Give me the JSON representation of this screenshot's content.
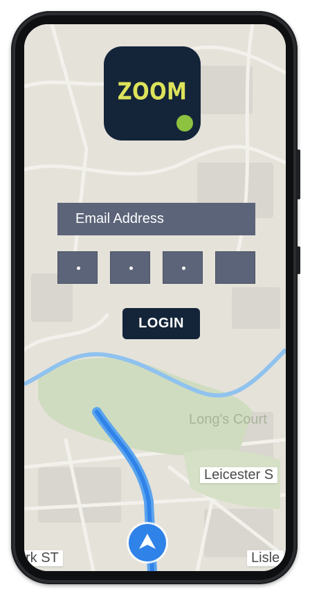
{
  "app": {
    "logo_text": "ZOOM",
    "colors": {
      "brand_navy": "#14253a",
      "logo_yellow": "#dde35a",
      "logo_dot_green": "#8cc23f",
      "field_gray": "#5c6479",
      "route_blue": "#2f82e8"
    }
  },
  "login_form": {
    "email_placeholder": "Email Address",
    "pin_values": [
      "•",
      "•",
      "•",
      ""
    ],
    "login_label": "LOGIN"
  },
  "map": {
    "labels": {
      "longs_court": "Long's Court",
      "leicester": "Leicester S",
      "york_st": "rk ST",
      "lisle": "Lisle"
    },
    "nav_icon": "navigation-arrow-icon"
  }
}
